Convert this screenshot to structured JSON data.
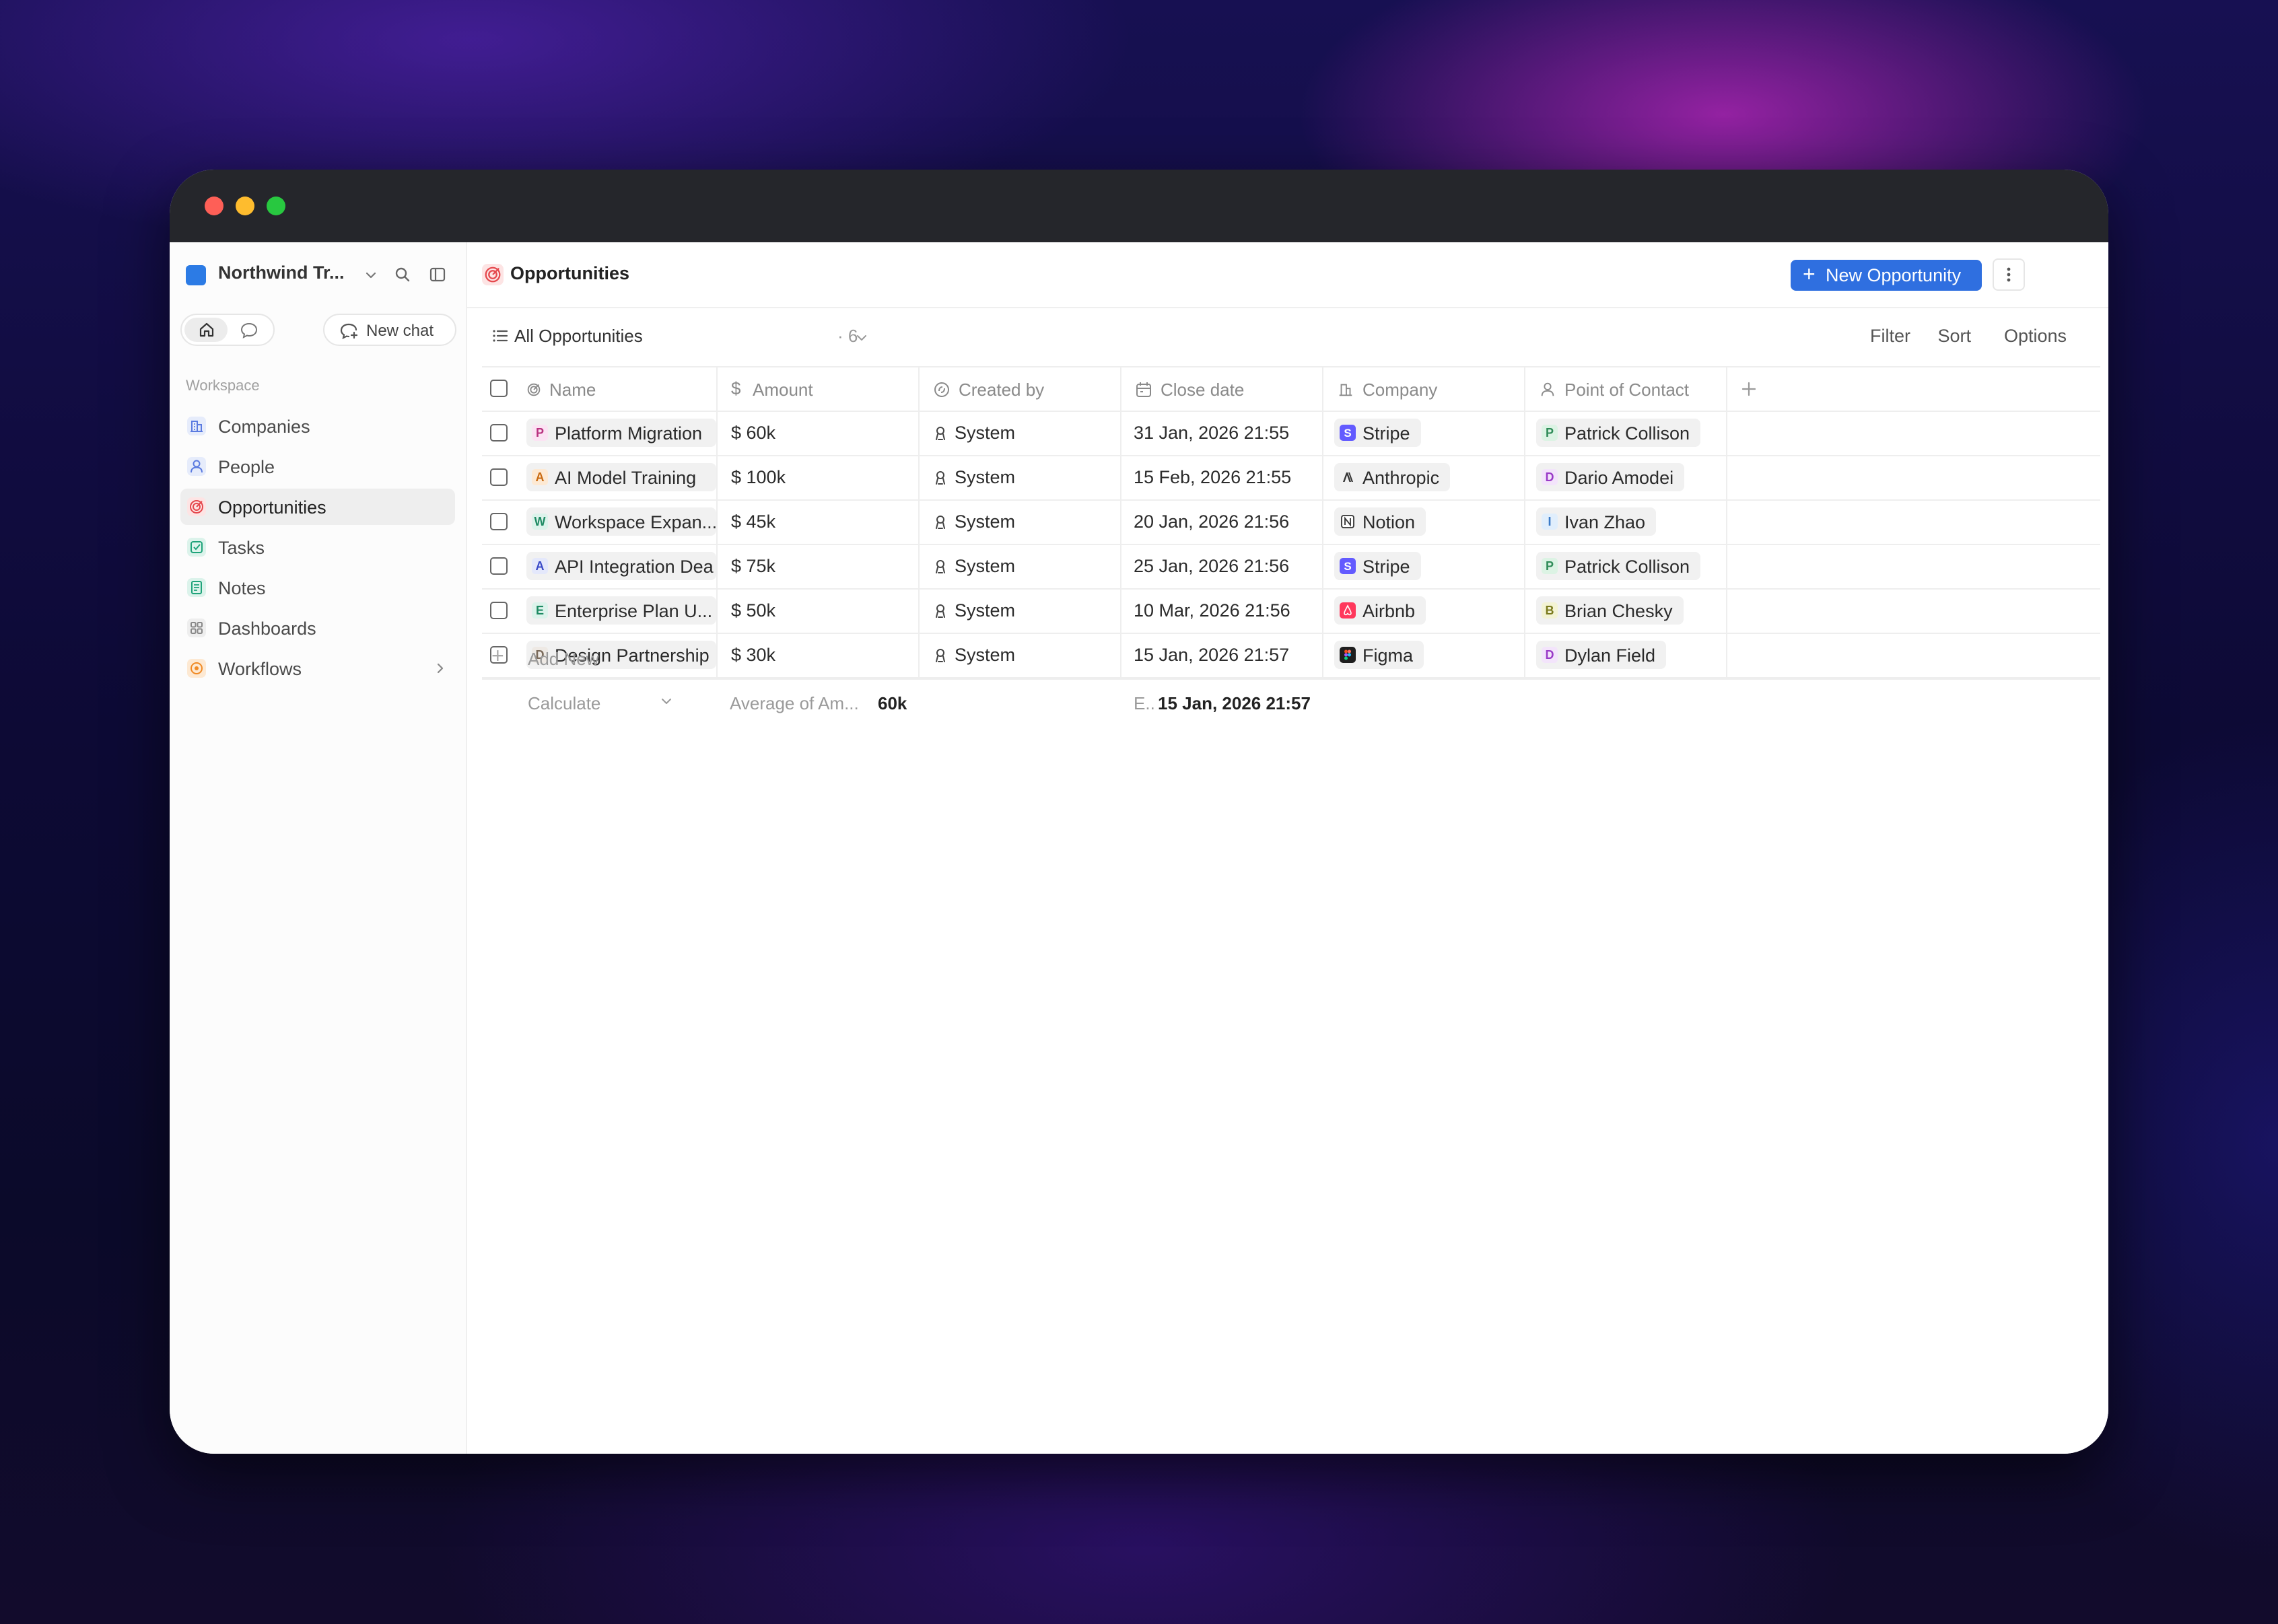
{
  "colors": {
    "accent": "#2f6fe0",
    "workspace_logo": "#2c7be5",
    "traffic_red": "#fe5f57",
    "traffic_yellow": "#febc2e",
    "traffic_green": "#28c840"
  },
  "sidebar": {
    "workspace_name": "Northwind Tr...",
    "new_chat_label": "New chat",
    "section_label": "Workspace",
    "items": [
      {
        "label": "Companies",
        "icon": "building-icon",
        "color": "#5b7be0"
      },
      {
        "label": "People",
        "icon": "person-icon",
        "color": "#5b7be0"
      },
      {
        "label": "Opportunities",
        "icon": "target-icon",
        "color": "#e5484d"
      },
      {
        "label": "Tasks",
        "icon": "checkbox-icon",
        "color": "#1fa37a"
      },
      {
        "label": "Notes",
        "icon": "note-icon",
        "color": "#1fa37a"
      },
      {
        "label": "Dashboards",
        "icon": "grid-icon",
        "color": "#888888"
      },
      {
        "label": "Workflows",
        "icon": "workflow-icon",
        "color": "#f08a24"
      }
    ]
  },
  "header": {
    "title": "Opportunities",
    "new_button_label": "New Opportunity"
  },
  "view": {
    "name": "All Opportunities",
    "count": "· 6",
    "filter_label": "Filter",
    "sort_label": "Sort",
    "options_label": "Options"
  },
  "table": {
    "columns": [
      "Name",
      "Amount",
      "Created by",
      "Close date",
      "Company",
      "Point of Contact"
    ],
    "rows": [
      {
        "name_initial": "P",
        "name": "Platform Migration",
        "amount": "$ 60k",
        "created_by": "System",
        "close_date": "31 Jan, 2026 21:55",
        "company": "Stripe",
        "company_icon": "stripe-logo-icon",
        "contact_initial": "P",
        "contact": "Patrick Collison"
      },
      {
        "name_initial": "A",
        "name": "AI Model Training",
        "amount": "$ 100k",
        "created_by": "System",
        "close_date": "15 Feb, 2026 21:55",
        "company": "Anthropic",
        "company_icon": "anthropic-logo-icon",
        "contact_initial": "D",
        "contact": "Dario Amodei"
      },
      {
        "name_initial": "W",
        "name": "Workspace Expan...",
        "amount": "$ 45k",
        "created_by": "System",
        "close_date": "20 Jan, 2026 21:56",
        "company": "Notion",
        "company_icon": "notion-logo-icon",
        "contact_initial": "I",
        "contact": "Ivan Zhao"
      },
      {
        "name_initial": "A",
        "name": "API Integration Dea",
        "amount": "$ 75k",
        "created_by": "System",
        "close_date": "25 Jan, 2026 21:56",
        "company": "Stripe",
        "company_icon": "stripe-logo-icon",
        "contact_initial": "P",
        "contact": "Patrick Collison"
      },
      {
        "name_initial": "E",
        "name": "Enterprise Plan U...",
        "amount": "$ 50k",
        "created_by": "System",
        "close_date": "10 Mar, 2026 21:56",
        "company": "Airbnb",
        "company_icon": "airbnb-logo-icon",
        "contact_initial": "B",
        "contact": "Brian Chesky"
      },
      {
        "name_initial": "D",
        "name": "Design Partnership",
        "amount": "$ 30k",
        "created_by": "System",
        "close_date": "15 Jan, 2026 21:57",
        "company": "Figma",
        "company_icon": "figma-logo-icon",
        "contact_initial": "D",
        "contact": "Dylan Field"
      }
    ],
    "add_new_label": "Add New",
    "calculate_label": "Calculate",
    "aggregate_amount_label": "Average of Am...",
    "aggregate_amount_value": "60k",
    "aggregate_date_label": "E..",
    "aggregate_date_value": "15 Jan, 2026 21:57"
  }
}
